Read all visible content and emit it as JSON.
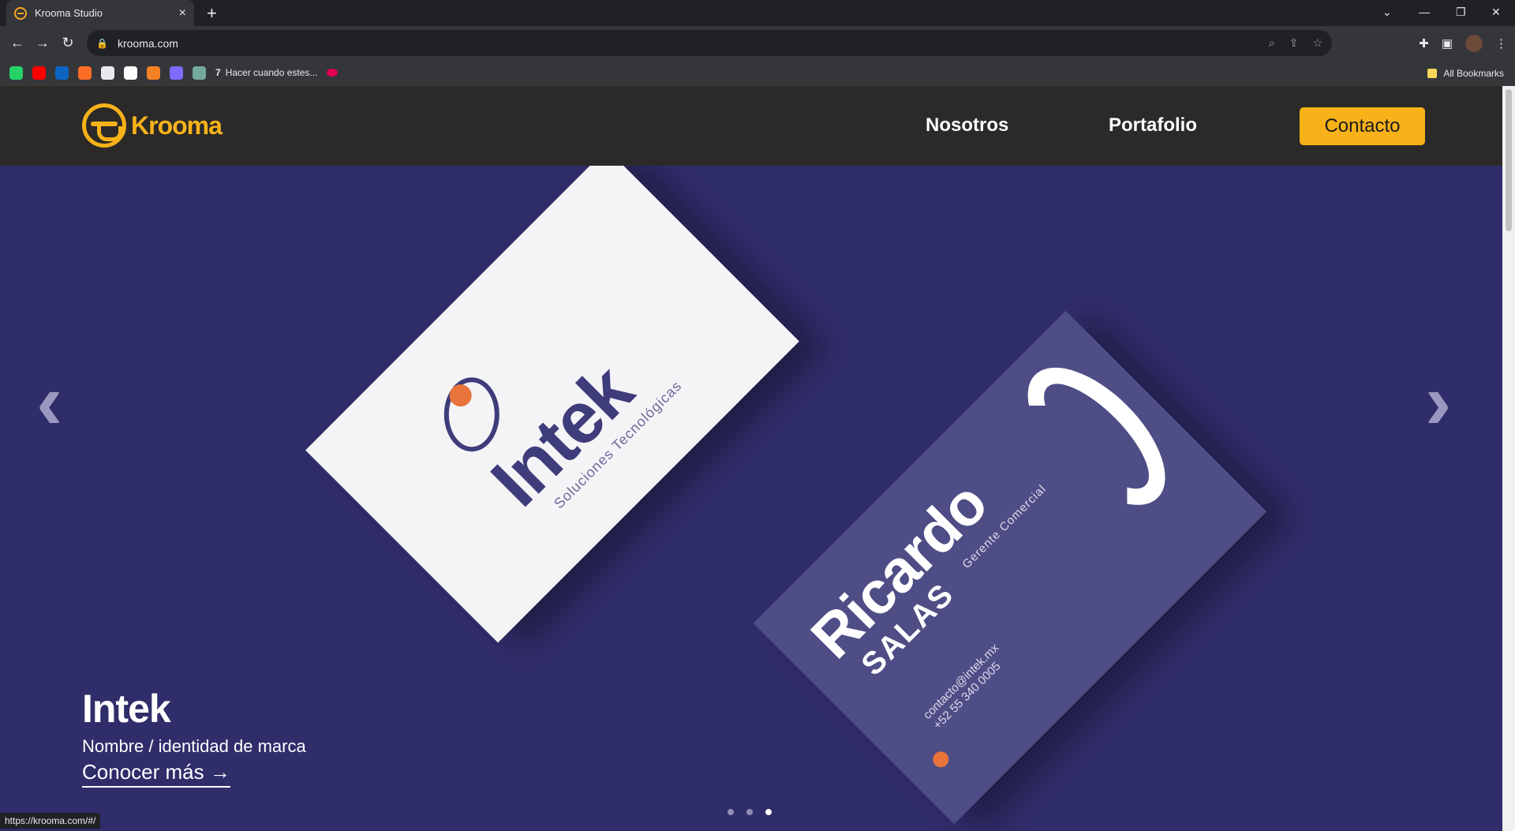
{
  "browser": {
    "tab_title": "Krooma Studio",
    "tab_close": "×",
    "new_tab": "+",
    "url": "krooma.com",
    "status_url": "https://krooma.com/#/",
    "bookmarks": [
      {
        "icon": "whatsapp-icon",
        "color": "#25d366"
      },
      {
        "icon": "youtube-icon",
        "color": "#ff0000"
      },
      {
        "icon": "linkedin-icon",
        "color": "#0a66c2"
      },
      {
        "icon": "gitlab-icon",
        "color": "#fc6d26"
      },
      {
        "icon": "github-icon",
        "color": "#e8eaed"
      },
      {
        "icon": "vercel-icon",
        "color": "#ffffff"
      },
      {
        "icon": "stackoverflow-icon",
        "color": "#f48024"
      },
      {
        "icon": "app-icon",
        "color": "#7b6cff"
      },
      {
        "icon": "openai-icon",
        "color": "#74aa9c"
      }
    ],
    "bookmark_label": "Hacer cuando estes...",
    "all_bookmarks": "All Bookmarks"
  },
  "site": {
    "logo_text": "Krooma",
    "nav": {
      "about": "Nosotros",
      "portfolio": "Portafolio",
      "contact": "Contacto"
    },
    "brand_color": "#f7b21a",
    "hero_bg": "#302d6b"
  },
  "slide": {
    "title": "Intek",
    "subtitle": "Nombre / identidad de marca",
    "link": "Conocer más →",
    "card_front": {
      "word": "Intek",
      "tagline": "Soluciones Tecnológicas"
    },
    "card_back": {
      "name": "Ricardo",
      "surname": "SALAS",
      "role": "Gerente Comercial",
      "email": "contacto@intek.mx",
      "phone": "+52 55 340 0005"
    },
    "prev": "‹",
    "next": "›",
    "dots_total": 3,
    "dots_active": 3
  }
}
